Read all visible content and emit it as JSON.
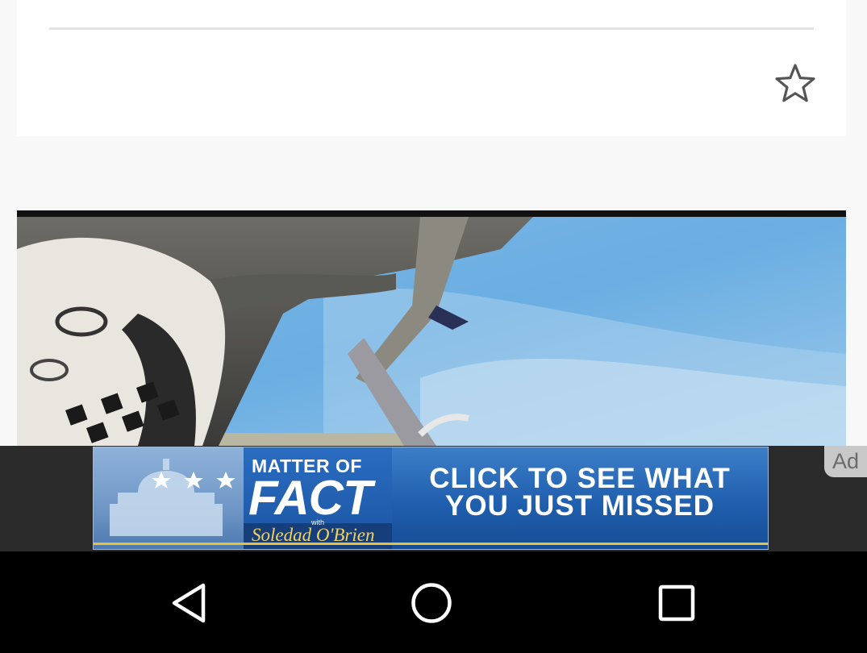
{
  "card": {
    "favorite_icon": "star-outline-icon"
  },
  "video": {
    "scene": "in-car racing camera"
  },
  "ad": {
    "brand_line1": "MATTER OF",
    "brand_line2": "FACT",
    "brand_with": "with",
    "brand_host": "Soledad O'Brien",
    "cta_line1": "CLICK TO SEE WHAT",
    "cta_line2": "YOU JUST MISSED",
    "label": "Ad",
    "colors": {
      "banner_blue": "#1f5fae",
      "gold": "#e8c23a"
    }
  },
  "navbar": {
    "back_icon": "back-triangle-icon",
    "home_icon": "home-circle-icon",
    "recents_icon": "recents-square-icon"
  }
}
